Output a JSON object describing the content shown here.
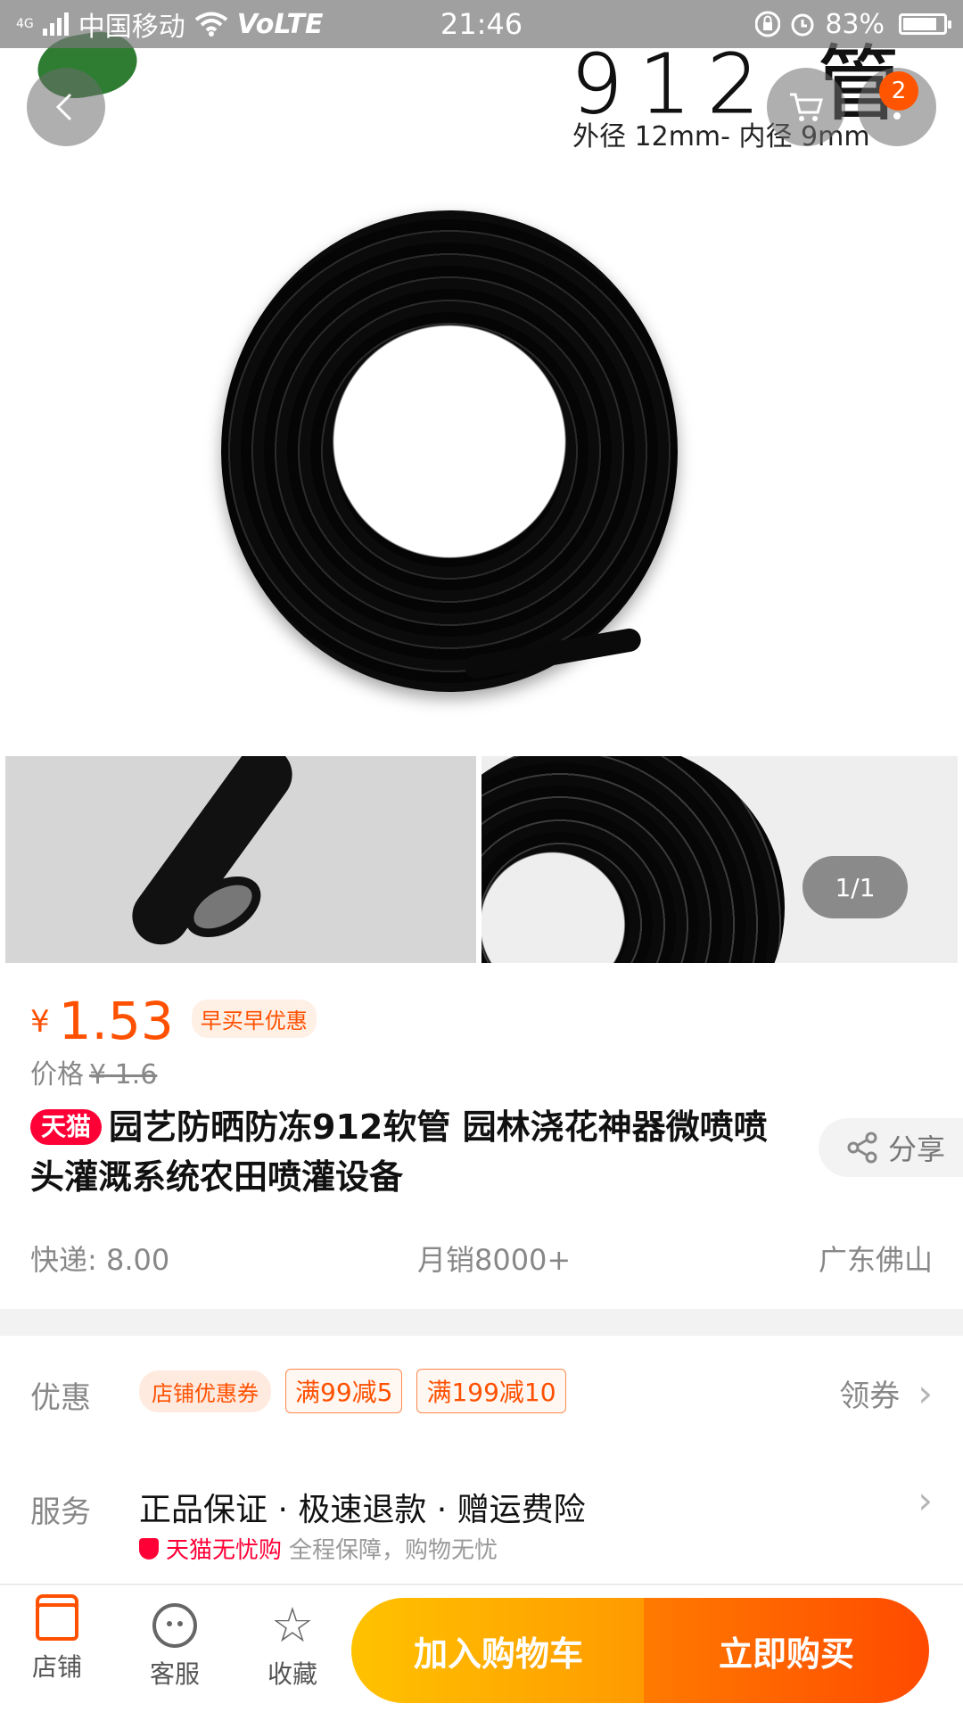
{
  "status_bar": {
    "network": "4G",
    "carrier": "中国移动",
    "volte": "VoLTE",
    "time": "21:46",
    "battery": "83%",
    "battery_level": 0.83
  },
  "header": {
    "cart_badge": "2",
    "image_text_title": "912 管",
    "image_text_subtitle": "外径 12mm- 内径 9mm",
    "page_indicator": "1/1"
  },
  "product": {
    "currency": "¥",
    "price": "1.53",
    "promo_tag": "早买早优惠",
    "original_label": "价格",
    "original_price": "¥ 1.6",
    "tmall_badge": "天猫",
    "title": "园艺防晒防冻912软管 园林浇花神器微喷喷头灌溉系统农田喷灌设备",
    "share": "分享"
  },
  "meta": {
    "shipping": "快递: 8.00",
    "monthly_sales": "月销8000+",
    "location": "广东佛山"
  },
  "coupons": {
    "label": "优惠",
    "store_coupon": "店铺优惠券",
    "items": [
      "满99减5",
      "满199减10"
    ],
    "action": "领券"
  },
  "service": {
    "label": "服务",
    "main": "正品保证 · 极速退款 · 赠运费险",
    "badge": "天猫无忧购",
    "sub": "全程保障，购物无忧"
  },
  "bottom_bar": {
    "store": "店铺",
    "customer_service": "客服",
    "favorite": "收藏",
    "add_to_cart": "加入购物车",
    "buy_now": "立即购买"
  },
  "colors": {
    "accent": "#ff5000",
    "tmall_red": "#ff0036",
    "cart_button": "#ffb000",
    "buy_button": "#ff6000"
  }
}
